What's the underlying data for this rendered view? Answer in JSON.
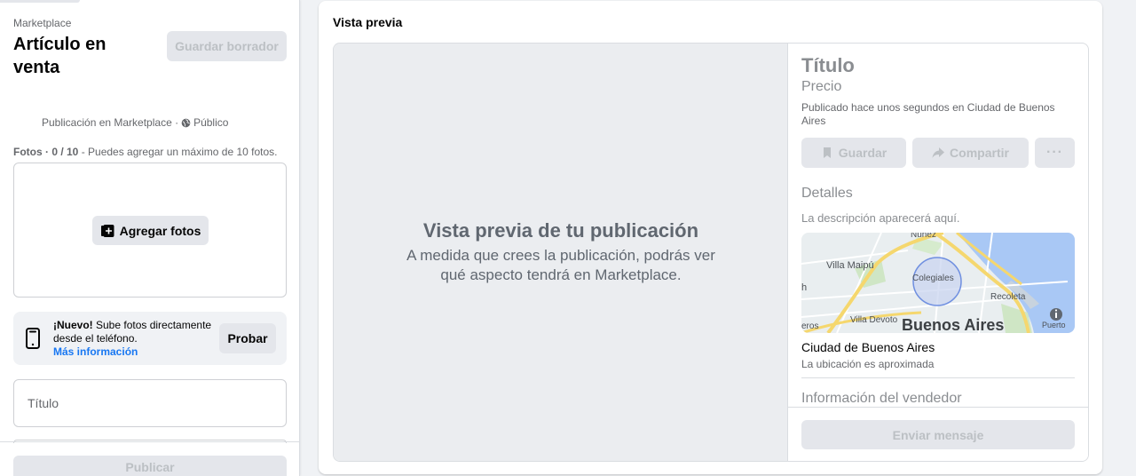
{
  "sidebar": {
    "breadcrumb": "Marketplace",
    "title": "Artículo en venta",
    "save_draft": "Guardar borrador",
    "listing_meta": "Publicación en Marketplace ·",
    "audience": "Público",
    "photos_label": "Fotos · 0 / 10",
    "photos_hint": " - Puedes agregar un máximo de 10 fotos.",
    "add_photos": "Agregar fotos",
    "phone_new": "¡Nuevo!",
    "phone_text": " Sube fotos directamente desde el teléfono.",
    "phone_more_info": "Más información",
    "phone_try": "Probar",
    "title_placeholder": "Título",
    "publish": "Publicar"
  },
  "preview": {
    "label": "Vista previa",
    "heading": "Vista previa de tu publicación",
    "subheading": "A medida que crees la publicación, podrás ver qué aspecto tendrá en Marketplace.",
    "title": "Título",
    "price": "Precio",
    "posted": "Publicado hace unos segundos en Ciudad de Buenos Aires",
    "save": "Guardar",
    "share": "Compartir",
    "more": "···",
    "details": "Detalles",
    "description": "La descripción aparecerá aquí.",
    "city": "Ciudad de Buenos Aires",
    "approx": "La ubicación es aproximada",
    "seller_info": "Información del vendedor",
    "send_message": "Enviar mensaje",
    "map": {
      "labels": [
        "Nuñez",
        "Villa Maipú",
        "Colegiales",
        "Recoleta",
        "Villa Devoto",
        "Buenos Aires",
        "Puerto",
        "eros",
        "h"
      ]
    }
  },
  "colors": {
    "accent": "#1877f2",
    "background": "#f0f2f5",
    "disabled_text": "#bcc0c4",
    "button_bg": "#e4e6eb"
  }
}
